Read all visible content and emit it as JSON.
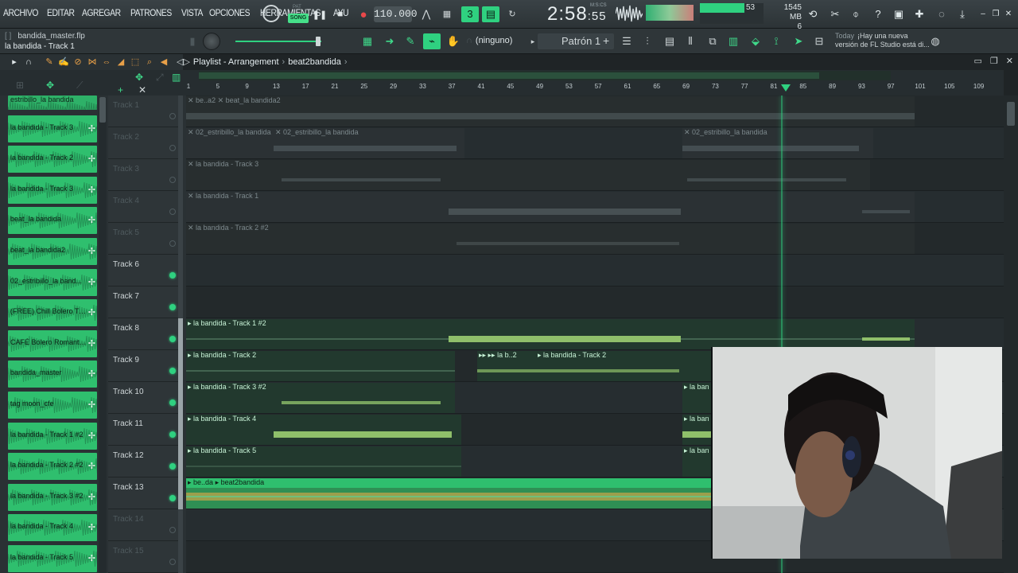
{
  "menu": [
    "ARCHIVO",
    "EDITAR",
    "AGREGAR",
    "PATRONES",
    "VISTA",
    "OPCIONES",
    "HERRAMIENTAS",
    "AYU"
  ],
  "transport": {
    "mode_pat": "PAT",
    "mode_song": "SONG",
    "tempo": "110.000",
    "time_main": "2:58",
    "time_sub": "55",
    "time_unit": "M:S:CS"
  },
  "cpu": {
    "value": "53",
    "memory": "1545 MB",
    "voices": "6"
  },
  "colors": {
    "accent": "#2fd180",
    "clip_green": "#2fbf6e",
    "bg": "#1f2426"
  },
  "file": {
    "brackets": "[ ]",
    "name": "bandida_master.flp",
    "hint": "la bandida - Track 1"
  },
  "snap": {
    "label": "(ninguno)"
  },
  "pattern": {
    "label": "Patrón 1"
  },
  "news": {
    "when": "Today",
    "text": "¡Hay una nueva versión de FL Studio está di..."
  },
  "playlist": {
    "title": "Playlist - Arrangement",
    "sep": "›",
    "arrangement": "beat2bandida"
  },
  "ruler_ticks": [
    "1",
    "5",
    "9",
    "13",
    "17",
    "21",
    "25",
    "29",
    "33",
    "37",
    "41",
    "45",
    "49",
    "53",
    "57",
    "61",
    "65",
    "69",
    "73",
    "77",
    "81",
    "85",
    "89",
    "93",
    "97",
    "101",
    "105",
    "109"
  ],
  "picker": [
    {
      "label": "estribillo_la bandida",
      "type": "audio"
    },
    {
      "label": "la bandida - Track 3",
      "type": "audio"
    },
    {
      "label": "la bandida - Track 2",
      "type": "audio"
    },
    {
      "label": "la bandida - Track 3",
      "type": "audio"
    },
    {
      "label": "beat_la bandida",
      "type": "audio"
    },
    {
      "label": "beat_la bandida2",
      "type": "audio"
    },
    {
      "label": "02_estribillo_la band...",
      "type": "audio"
    },
    {
      "label": "(FREE) Chill Bolero Ty...",
      "type": "audio"
    },
    {
      "label": "CAFÉ Bolero Romanti...",
      "type": "audio"
    },
    {
      "label": "bandida_master",
      "type": "audio"
    },
    {
      "label": "tag moon_cfe",
      "type": "audio"
    },
    {
      "label": "la bandida - Track 1 #2",
      "type": "audio"
    },
    {
      "label": "la bandida - Track 2 #2",
      "type": "audio"
    },
    {
      "label": "la bandida - Track 3 #2",
      "type": "audio"
    },
    {
      "label": "la bandida - Track 4",
      "type": "audio"
    },
    {
      "label": "la bandida - Track 5",
      "type": "audio"
    }
  ],
  "tracks": [
    {
      "name": "Track 1",
      "active": false
    },
    {
      "name": "Track 2",
      "active": false
    },
    {
      "name": "Track 3",
      "active": false
    },
    {
      "name": "Track 4",
      "active": false
    },
    {
      "name": "Track 5",
      "active": false
    },
    {
      "name": "Track 6",
      "active": true
    },
    {
      "name": "Track 7",
      "active": true
    },
    {
      "name": "Track 8",
      "active": true
    },
    {
      "name": "Track 9",
      "active": true
    },
    {
      "name": "Track 10",
      "active": true
    },
    {
      "name": "Track 11",
      "active": true
    },
    {
      "name": "Track 12",
      "active": true
    },
    {
      "name": "Track 13",
      "active": true
    },
    {
      "name": "Track 14",
      "active": false
    },
    {
      "name": "Track 15",
      "active": false
    }
  ],
  "clips": {
    "t1a": "be..a2",
    "t1b": "beat_la bandida2",
    "t2a": "02_estribillo_la bandida",
    "t2b": "02_estribillo_la bandida",
    "t2c": "02_estribillo_la bandida",
    "t3": "la bandida - Track 3",
    "t4": "la bandida - Track 1",
    "t5": "la bandida - Track 2 #2",
    "t8": "la bandida - Track 1 #2",
    "t9a": "la bandida - Track 2",
    "t9b": "la b..2",
    "t9c": "la bandida - Track 2",
    "t10a": "la bandida - Track 3 #2",
    "t10b": "la ban",
    "t11a": "la bandida - Track 4",
    "t11b": "la ban",
    "t12a": "la bandida - Track 5",
    "t12b": "la ban",
    "t13a": "be..da",
    "t13b": "beat2bandida"
  }
}
